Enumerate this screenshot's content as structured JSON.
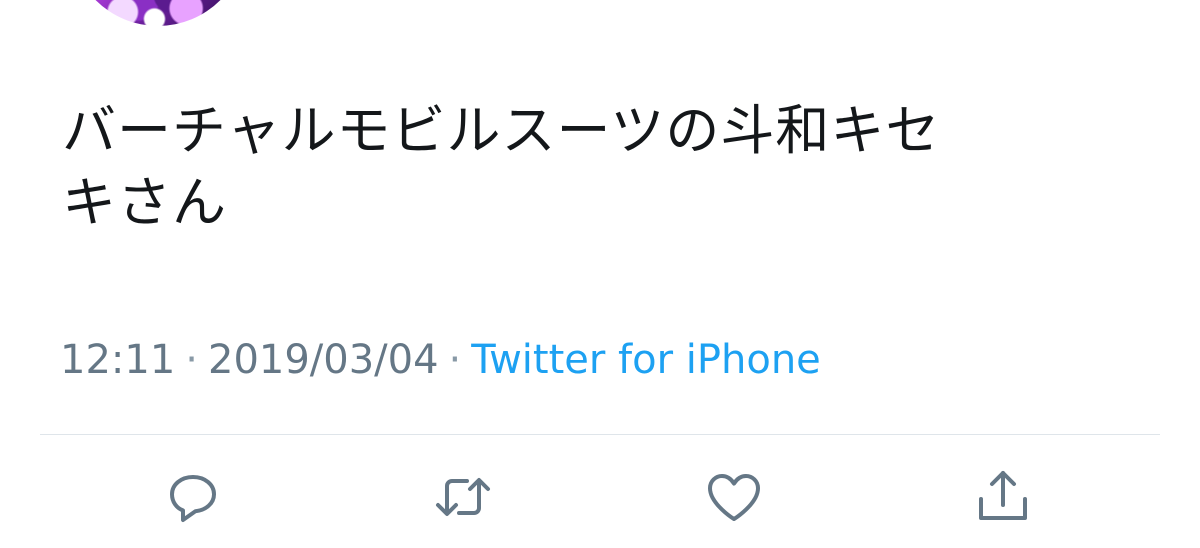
{
  "tweet": {
    "text_line1": "バーチャルモビルスーツの斗和キセ",
    "text_line2": "キさん"
  },
  "meta": {
    "time": "12:11",
    "date": "2019/03/04",
    "separator": "·",
    "source": "Twitter for iPhone"
  },
  "actions": [
    {
      "name": "reply",
      "icon": "reply-icon"
    },
    {
      "name": "retweet",
      "icon": "retweet-icon"
    },
    {
      "name": "like",
      "icon": "heart-icon"
    },
    {
      "name": "share",
      "icon": "share-icon"
    }
  ],
  "colors": {
    "text": "#14171a",
    "secondary": "#657786",
    "link": "#1da1f2",
    "divider": "#dfe5ea"
  }
}
